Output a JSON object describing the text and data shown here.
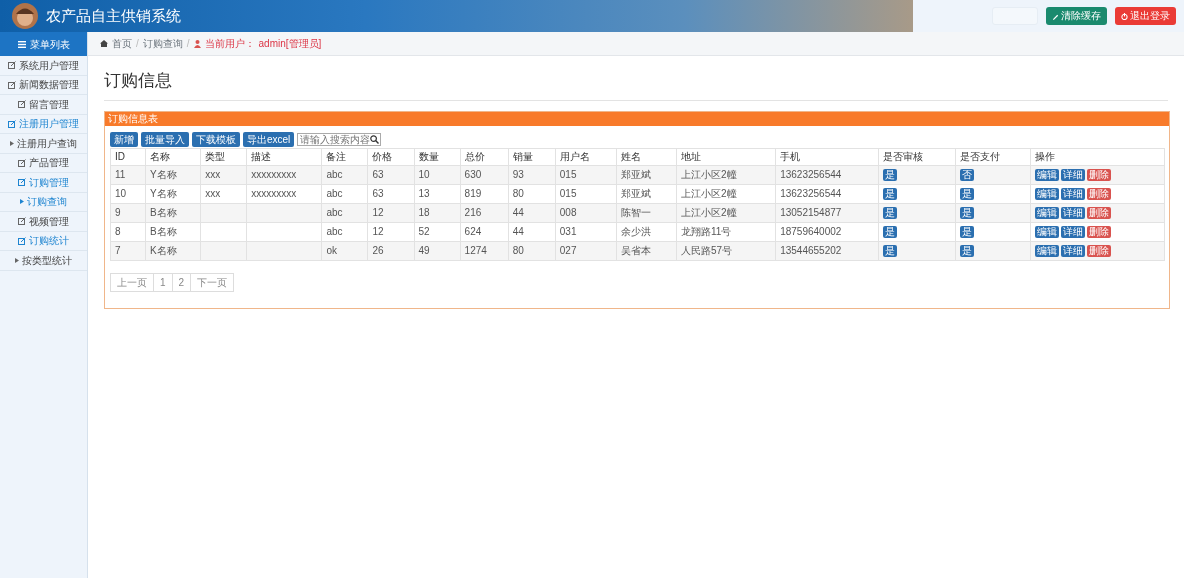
{
  "header": {
    "title": "农产品自主供销系统",
    "buttons": [
      {
        "kind": "faint"
      },
      {
        "label": "清除缓存",
        "kind": "clear"
      },
      {
        "label": "退出登录",
        "kind": "logout"
      }
    ]
  },
  "sidebar": {
    "title": "菜单列表",
    "items": [
      {
        "label": "系统用户管理",
        "kind": "group",
        "active": false
      },
      {
        "label": "新闻数据管理",
        "kind": "group",
        "active": false
      },
      {
        "label": "留言管理",
        "kind": "group",
        "active": false
      },
      {
        "label": "注册用户管理",
        "kind": "group",
        "active": true
      },
      {
        "label": "注册用户查询",
        "kind": "sub",
        "active": false
      },
      {
        "label": "产品管理",
        "kind": "group",
        "active": false
      },
      {
        "label": "订购管理",
        "kind": "group",
        "active": true
      },
      {
        "label": "订购查询",
        "kind": "sub",
        "active": true
      },
      {
        "label": "视频管理",
        "kind": "group",
        "active": false
      },
      {
        "label": "订购统计",
        "kind": "group",
        "active": true
      },
      {
        "label": "按类型统计",
        "kind": "sub",
        "active": false
      }
    ]
  },
  "breadcrumb": {
    "items": [
      {
        "label": "首页",
        "separator": "/"
      },
      {
        "label": "订购查询",
        "separator": "/"
      }
    ],
    "user_label": "当前用户：",
    "user": "admin[管理员]"
  },
  "page_title": "订购信息",
  "panel": {
    "title": "订购信息表",
    "toolbar": [
      "新增",
      "批量导入",
      "下载模板",
      "导出excel"
    ],
    "search": {
      "placeholder": "请输入搜索内容"
    }
  },
  "table": {
    "columns": [
      "ID",
      "名称",
      "类型",
      "描述",
      "备注",
      "价格",
      "数量",
      "总价",
      "销量",
      "用户名",
      "姓名",
      "地址",
      "手机",
      "是否审核",
      "是否支付",
      "操作"
    ],
    "rows": [
      {
        "cells": [
          "11",
          "Y名称",
          "xxx",
          "xxxxxxxxx",
          "abc",
          "63",
          "10",
          "630",
          "93",
          "015",
          "郑亚斌",
          "上江小区2幢",
          "13623256544",
          "是",
          "否"
        ],
        "actions": [
          {
            "label": "编辑",
            "kind": "edit"
          },
          {
            "label": "详细",
            "kind": "detail"
          },
          {
            "label": "删除",
            "kind": "delete"
          }
        ]
      },
      {
        "cells": [
          "10",
          "Y名称",
          "xxx",
          "xxxxxxxxx",
          "abc",
          "63",
          "13",
          "819",
          "80",
          "015",
          "郑亚斌",
          "上江小区2幢",
          "13623256544",
          "是",
          "是"
        ],
        "actions": [
          {
            "label": "编辑",
            "kind": "edit"
          },
          {
            "label": "详细",
            "kind": "detail"
          },
          {
            "label": "删除",
            "kind": "delete"
          }
        ]
      },
      {
        "cells": [
          "9",
          "B名称",
          "",
          "",
          "abc",
          "12",
          "18",
          "216",
          "44",
          "008",
          "陈智一",
          "上江小区2幢",
          "13052154877",
          "是",
          "是"
        ],
        "actions": [
          {
            "label": "编辑",
            "kind": "edit"
          },
          {
            "label": "详细",
            "kind": "detail"
          },
          {
            "label": "删除",
            "kind": "delete"
          }
        ]
      },
      {
        "cells": [
          "8",
          "B名称",
          "",
          "",
          "abc",
          "12",
          "52",
          "624",
          "44",
          "031",
          "余少洪",
          "龙翔路11号",
          "18759640002",
          "是",
          "是"
        ],
        "actions": [
          {
            "label": "编辑",
            "kind": "edit"
          },
          {
            "label": "详细",
            "kind": "detail"
          },
          {
            "label": "删除",
            "kind": "delete"
          }
        ]
      },
      {
        "cells": [
          "7",
          "K名称",
          "",
          "",
          "ok",
          "26",
          "49",
          "1274",
          "80",
          "027",
          "吴省本",
          "人民路57号",
          "13544655202",
          "是",
          "是"
        ],
        "actions": [
          {
            "label": "编辑",
            "kind": "edit"
          },
          {
            "label": "详细",
            "kind": "detail"
          },
          {
            "label": "删除",
            "kind": "delete"
          }
        ]
      }
    ]
  },
  "pagination": [
    {
      "label": "上一页",
      "selected": false
    },
    {
      "label": "1",
      "selected": false
    },
    {
      "label": "2",
      "selected": false
    },
    {
      "label": "下一页",
      "selected": false
    }
  ]
}
